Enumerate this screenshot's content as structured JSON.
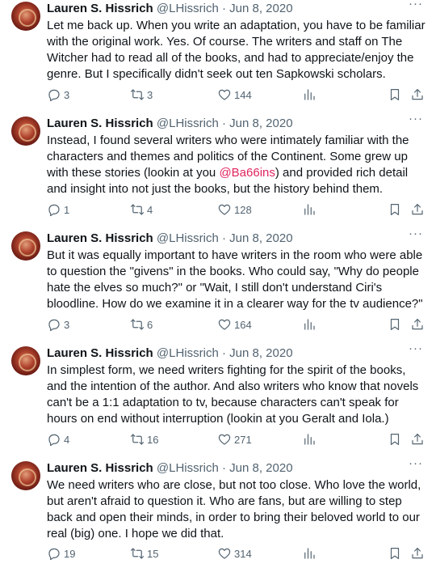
{
  "tweets": [
    {
      "name": "Lauren S. Hissrich",
      "handle": "@LHissrich",
      "date": "Jun 8, 2020",
      "more": "···",
      "text_before": "Let me back up. When you write an adaptation, you have to be familiar with the original work. Yes. Of course. The writers and staff on The Witcher had to read all of the books, and had to appreciate/enjoy the genre. But I specifically didn't seek out ten Sapkowski scholars.",
      "mention": "",
      "text_after": "",
      "replies": "3",
      "retweets": "3",
      "likes": "144"
    },
    {
      "name": "Lauren S. Hissrich",
      "handle": "@LHissrich",
      "date": "Jun 8, 2020",
      "more": "···",
      "text_before": "Instead, I found several writers who were intimately familiar with the characters and themes and politics of the Continent. Some grew up with these stories (lookin at you ",
      "mention": "@Ba66ins",
      "text_after": ") and provided rich detail and insight into not just the books, but the history behind them.",
      "replies": "1",
      "retweets": "4",
      "likes": "128"
    },
    {
      "name": "Lauren S. Hissrich",
      "handle": "@LHissrich",
      "date": "Jun 8, 2020",
      "more": "···",
      "text_before": "But it was equally important to have writers in the room who were able to question the \"givens\" in the books. Who could say, \"Why do people hate the elves so much?\" or \"Wait, I still don't understand Ciri's bloodline. How do we examine it in a clearer way for the tv audience?\"",
      "mention": "",
      "text_after": "",
      "replies": "3",
      "retweets": "6",
      "likes": "164"
    },
    {
      "name": "Lauren S. Hissrich",
      "handle": "@LHissrich",
      "date": "Jun 8, 2020",
      "more": "···",
      "text_before": "In simplest form, we need writers fighting for the spirit of the books, and the intention of the author. And also writers who know that novels can't be a 1:1 adaptation to tv, because characters can't speak for hours on end without interruption (lookin at you Geralt and Iola.)",
      "mention": "",
      "text_after": "",
      "replies": "4",
      "retweets": "16",
      "likes": "271"
    },
    {
      "name": "Lauren S. Hissrich",
      "handle": "@LHissrich",
      "date": "Jun 8, 2020",
      "more": "···",
      "text_before": "We need writers who are close, but not too close. Who love the world, but aren't afraid to question it. Who are fans, but are willing to step back and open their minds, in order to bring their beloved world to our real (big) one. I hope we did that.",
      "mention": "",
      "text_after": "",
      "replies": "19",
      "retweets": "15",
      "likes": "314"
    }
  ],
  "separator": "·"
}
